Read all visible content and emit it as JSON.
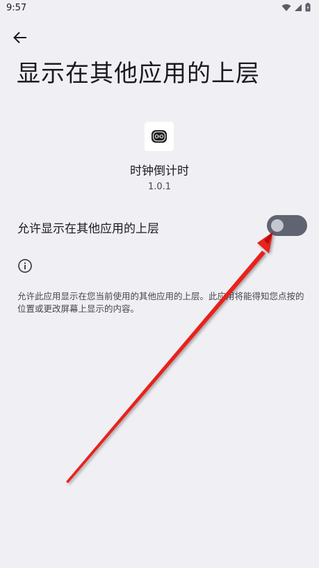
{
  "status_bar": {
    "time": "9:57",
    "icons": [
      "wifi-icon",
      "signal-icon",
      "battery-icon"
    ]
  },
  "header": {
    "back_icon": "arrow-back-icon",
    "title": "显示在其他应用的上层"
  },
  "app": {
    "icon": "clock-app-icon",
    "name": "时钟倒计时",
    "version": "1.0.1"
  },
  "permission": {
    "label": "允许显示在其他应用的上层",
    "enabled": false
  },
  "info": {
    "icon": "info-icon",
    "text": "允许此应用显示在您当前使用的其他应用的上层。此应用将能得知您点按的位置或更改屏幕上显示的内容。"
  },
  "colors": {
    "background": "#f0f0f4",
    "toggle_track_off": "#5f6470",
    "toggle_thumb_off": "#c4c6d0",
    "annotation_arrow": "#e8201a"
  }
}
